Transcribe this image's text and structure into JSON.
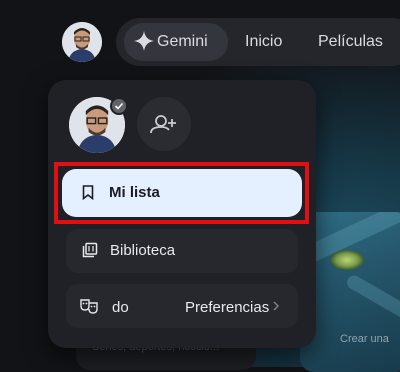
{
  "nav": {
    "gemini_label": "Gemini",
    "items": [
      {
        "label": "Inicio"
      },
      {
        "label": "Películas"
      }
    ]
  },
  "menu": {
    "items": [
      {
        "label": "Mi lista",
        "icon": "bookmark-icon",
        "selected": true
      },
      {
        "label": "Biblioteca",
        "icon": "library-icon"
      },
      {
        "label": "do",
        "icon": "theater-masks-icon"
      }
    ],
    "preferences_label": "Preferencias",
    "add_profile_icon": "add-person-icon"
  },
  "background": {
    "cat_caption": "Crear una",
    "left_caption": "Series, deportes, noticio..."
  },
  "colors": {
    "highlight_outline": "#e10e12",
    "selected_row_bg": "#e4efff",
    "menu_bg": "#1f2126"
  }
}
